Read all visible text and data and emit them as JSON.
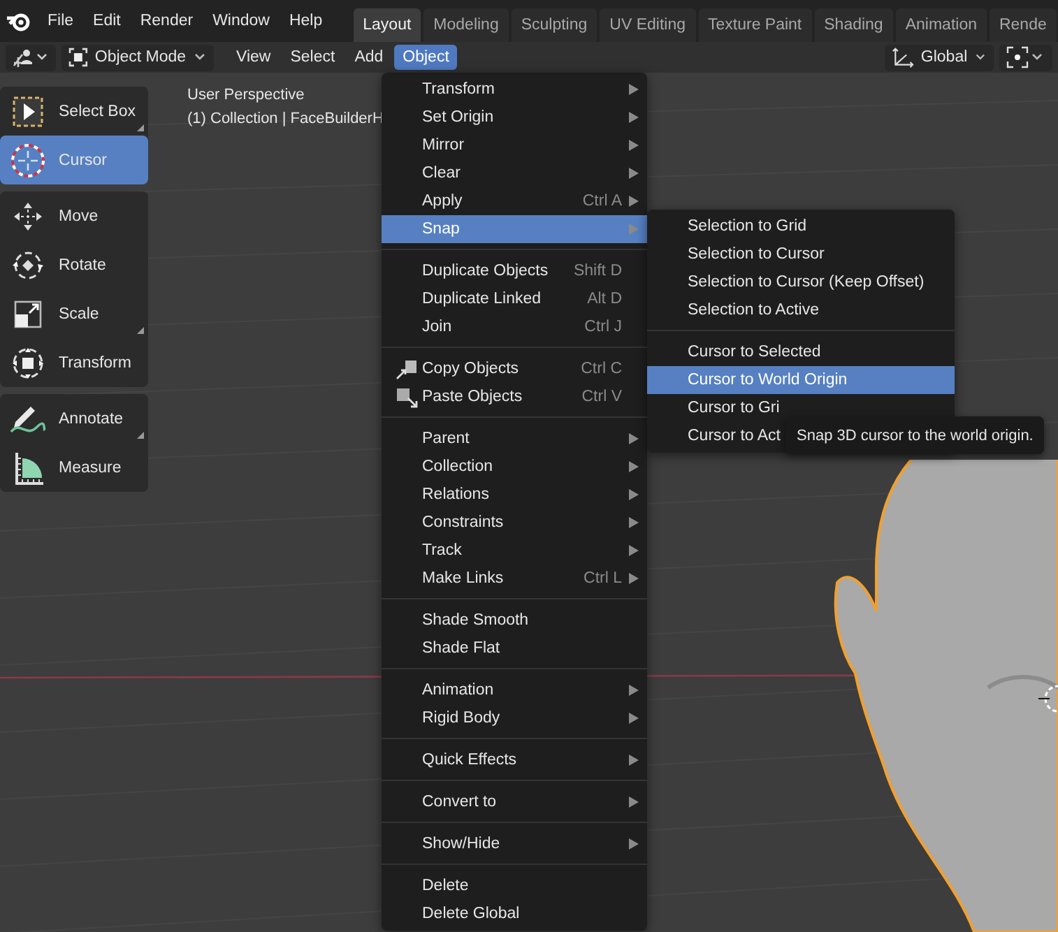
{
  "top_menu": [
    "File",
    "Edit",
    "Render",
    "Window",
    "Help"
  ],
  "workspace_tabs": [
    {
      "label": "Layout",
      "selected": true
    },
    {
      "label": "Modeling",
      "selected": false
    },
    {
      "label": "Sculpting",
      "selected": false
    },
    {
      "label": "UV Editing",
      "selected": false
    },
    {
      "label": "Texture Paint",
      "selected": false
    },
    {
      "label": "Shading",
      "selected": false
    },
    {
      "label": "Animation",
      "selected": false
    },
    {
      "label": "Rende",
      "selected": false
    }
  ],
  "header": {
    "mode": "Object Mode",
    "menus": [
      {
        "label": "View",
        "selected": false
      },
      {
        "label": "Select",
        "selected": false
      },
      {
        "label": "Add",
        "selected": false
      },
      {
        "label": "Object",
        "selected": true
      }
    ],
    "orientation": "Global"
  },
  "toolbar": [
    [
      {
        "kind": "select_box",
        "label": "Select Box",
        "selected": false,
        "has_variants": true
      },
      {
        "kind": "cursor",
        "label": "Cursor",
        "selected": true,
        "has_variants": false
      }
    ],
    [
      {
        "kind": "move",
        "label": "Move",
        "selected": false,
        "has_variants": false
      },
      {
        "kind": "rotate",
        "label": "Rotate",
        "selected": false,
        "has_variants": false
      },
      {
        "kind": "scale",
        "label": "Scale",
        "selected": false,
        "has_variants": true
      },
      {
        "kind": "transform",
        "label": "Transform",
        "selected": false,
        "has_variants": false
      }
    ],
    [
      {
        "kind": "annotate",
        "label": "Annotate",
        "selected": false,
        "has_variants": true
      },
      {
        "kind": "measure",
        "label": "Measure",
        "selected": false,
        "has_variants": false
      }
    ]
  ],
  "viewport": {
    "view_name": "User Perspective",
    "collection_info": "(1) Collection | FaceBuilderH"
  },
  "object_menu": [
    [
      {
        "kind": "plain",
        "label": "Transform",
        "submenu": true,
        "selected": false
      },
      {
        "kind": "plain",
        "label": "Set Origin",
        "submenu": true,
        "selected": false
      },
      {
        "kind": "plain",
        "label": "Mirror",
        "submenu": true,
        "selected": false
      },
      {
        "kind": "plain",
        "label": "Clear",
        "submenu": true,
        "selected": false
      },
      {
        "kind": "plain",
        "label": "Apply",
        "shortcut": "Ctrl A",
        "submenu": true,
        "selected": false
      },
      {
        "kind": "plain",
        "label": "Snap",
        "submenu": true,
        "selected": true
      }
    ],
    [
      {
        "kind": "plain",
        "label": "Duplicate Objects",
        "shortcut": "Shift D",
        "submenu": false,
        "selected": false
      },
      {
        "kind": "plain",
        "label": "Duplicate Linked",
        "shortcut": "Alt D",
        "submenu": false,
        "selected": false
      },
      {
        "kind": "plain",
        "label": "Join",
        "shortcut": "Ctrl J",
        "submenu": false,
        "selected": false
      }
    ],
    [
      {
        "kind": "copy",
        "label": "Copy Objects",
        "shortcut": "Ctrl C",
        "submenu": false,
        "selected": false
      },
      {
        "kind": "paste",
        "label": "Paste Objects",
        "shortcut": "Ctrl V",
        "submenu": false,
        "selected": false
      }
    ],
    [
      {
        "kind": "plain",
        "label": "Parent",
        "submenu": true,
        "selected": false
      },
      {
        "kind": "plain",
        "label": "Collection",
        "submenu": true,
        "selected": false
      },
      {
        "kind": "plain",
        "label": "Relations",
        "submenu": true,
        "selected": false
      },
      {
        "kind": "plain",
        "label": "Constraints",
        "submenu": true,
        "selected": false
      },
      {
        "kind": "plain",
        "label": "Track",
        "submenu": true,
        "selected": false
      },
      {
        "kind": "plain",
        "label": "Make Links",
        "shortcut": "Ctrl L",
        "submenu": true,
        "selected": false
      }
    ],
    [
      {
        "kind": "plain",
        "label": "Shade Smooth",
        "submenu": false,
        "selected": false
      },
      {
        "kind": "plain",
        "label": "Shade Flat",
        "submenu": false,
        "selected": false
      }
    ],
    [
      {
        "kind": "plain",
        "label": "Animation",
        "submenu": true,
        "selected": false
      },
      {
        "kind": "plain",
        "label": "Rigid Body",
        "submenu": true,
        "selected": false
      }
    ],
    [
      {
        "kind": "plain",
        "label": "Quick Effects",
        "submenu": true,
        "selected": false
      }
    ],
    [
      {
        "kind": "plain",
        "label": "Convert to",
        "submenu": true,
        "selected": false
      }
    ],
    [
      {
        "kind": "plain",
        "label": "Show/Hide",
        "submenu": true,
        "selected": false
      }
    ],
    [
      {
        "kind": "plain",
        "label": "Delete",
        "submenu": false,
        "selected": false
      },
      {
        "kind": "plain",
        "label": "Delete Global",
        "submenu": false,
        "selected": false
      }
    ]
  ],
  "snap_submenu": [
    [
      {
        "label": "Selection to Grid",
        "selected": false
      },
      {
        "label": "Selection to Cursor",
        "selected": false
      },
      {
        "label": "Selection to Cursor (Keep Offset)",
        "selected": false
      },
      {
        "label": "Selection to Active",
        "selected": false
      }
    ],
    [
      {
        "label": "Cursor to Selected",
        "selected": false
      },
      {
        "label": "Cursor to World Origin",
        "selected": true
      },
      {
        "label": "Cursor to Gri",
        "selected": false
      },
      {
        "label": "Cursor to Act",
        "selected": false
      }
    ]
  ],
  "tooltip": "Snap 3D cursor to the world origin."
}
